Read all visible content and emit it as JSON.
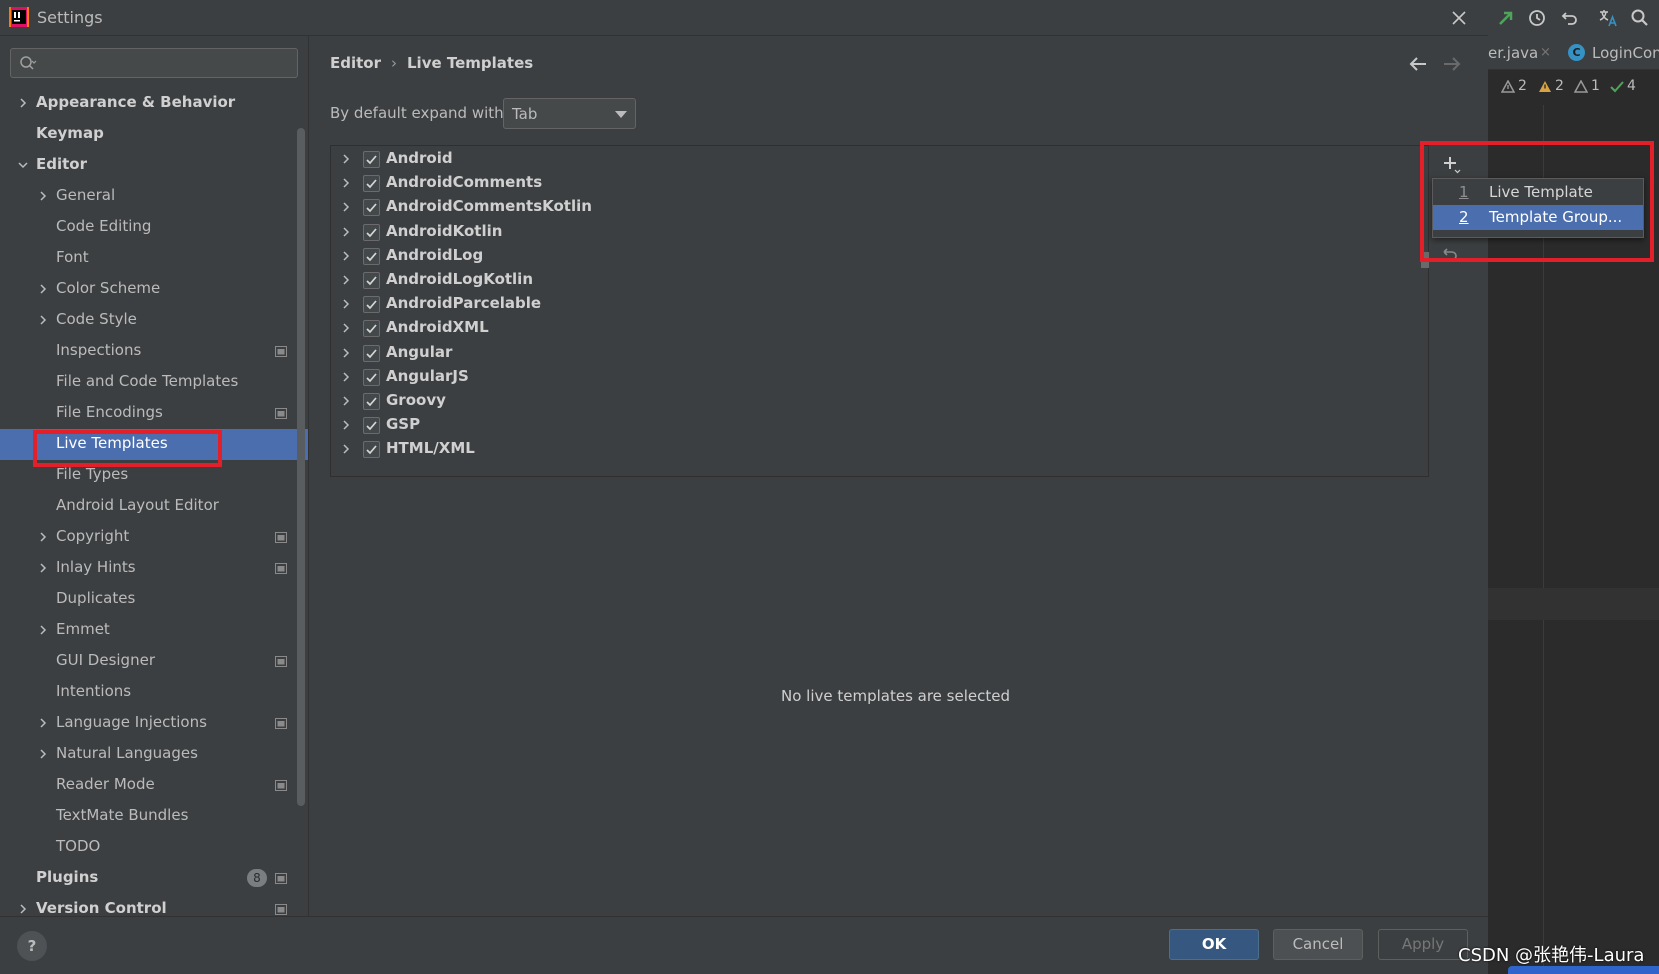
{
  "window": {
    "title": "Settings"
  },
  "sidebar": {
    "search_placeholder": "",
    "items": [
      {
        "label": "Appearance & Behavior"
      },
      {
        "label": "Keymap"
      },
      {
        "label": "Editor"
      },
      {
        "label": "General"
      },
      {
        "label": "Code Editing"
      },
      {
        "label": "Font"
      },
      {
        "label": "Color Scheme"
      },
      {
        "label": "Code Style"
      },
      {
        "label": "Inspections"
      },
      {
        "label": "File and Code Templates"
      },
      {
        "label": "File Encodings"
      },
      {
        "label": "Live Templates"
      },
      {
        "label": "File Types"
      },
      {
        "label": "Android Layout Editor"
      },
      {
        "label": "Copyright"
      },
      {
        "label": "Inlay Hints"
      },
      {
        "label": "Duplicates"
      },
      {
        "label": "Emmet"
      },
      {
        "label": "GUI Designer"
      },
      {
        "label": "Intentions"
      },
      {
        "label": "Language Injections"
      },
      {
        "label": "Natural Languages"
      },
      {
        "label": "Reader Mode"
      },
      {
        "label": "TextMate Bundles"
      },
      {
        "label": "TODO"
      },
      {
        "label": "Plugins"
      },
      {
        "label": "Version Control"
      }
    ],
    "plugins_badge": "8"
  },
  "breadcrumb": {
    "parent": "Editor",
    "separator": "›",
    "current": "Live Templates"
  },
  "expand": {
    "label": "By default expand with",
    "value": "Tab"
  },
  "template_groups": [
    "Android",
    "AndroidComments",
    "AndroidCommentsKotlin",
    "AndroidKotlin",
    "AndroidLog",
    "AndroidLogKotlin",
    "AndroidParcelable",
    "AndroidXML",
    "Angular",
    "AngularJS",
    "Groovy",
    "GSP",
    "HTML/XML"
  ],
  "popup_menu": [
    {
      "num": "1",
      "label": "Live Template"
    },
    {
      "num": "2",
      "label": "Template Group..."
    }
  ],
  "empty_message": "No live templates are selected",
  "footer": {
    "ok": "OK",
    "cancel": "Cancel",
    "apply": "Apply",
    "help": "?"
  },
  "ide": {
    "tab1": "er.java",
    "tab1_close": "×",
    "tab2_icon": "C",
    "tab2": "LoginCon",
    "inspections": {
      "warn_gray": "2",
      "warn_yellow": "2",
      "weak": "1",
      "ok": "4"
    }
  },
  "watermark": "CSDN @张艳伟-Laura",
  "colors": {
    "accent": "#4b6eaf",
    "highlight_box": "#e3202a",
    "ok_button": "#365880"
  }
}
